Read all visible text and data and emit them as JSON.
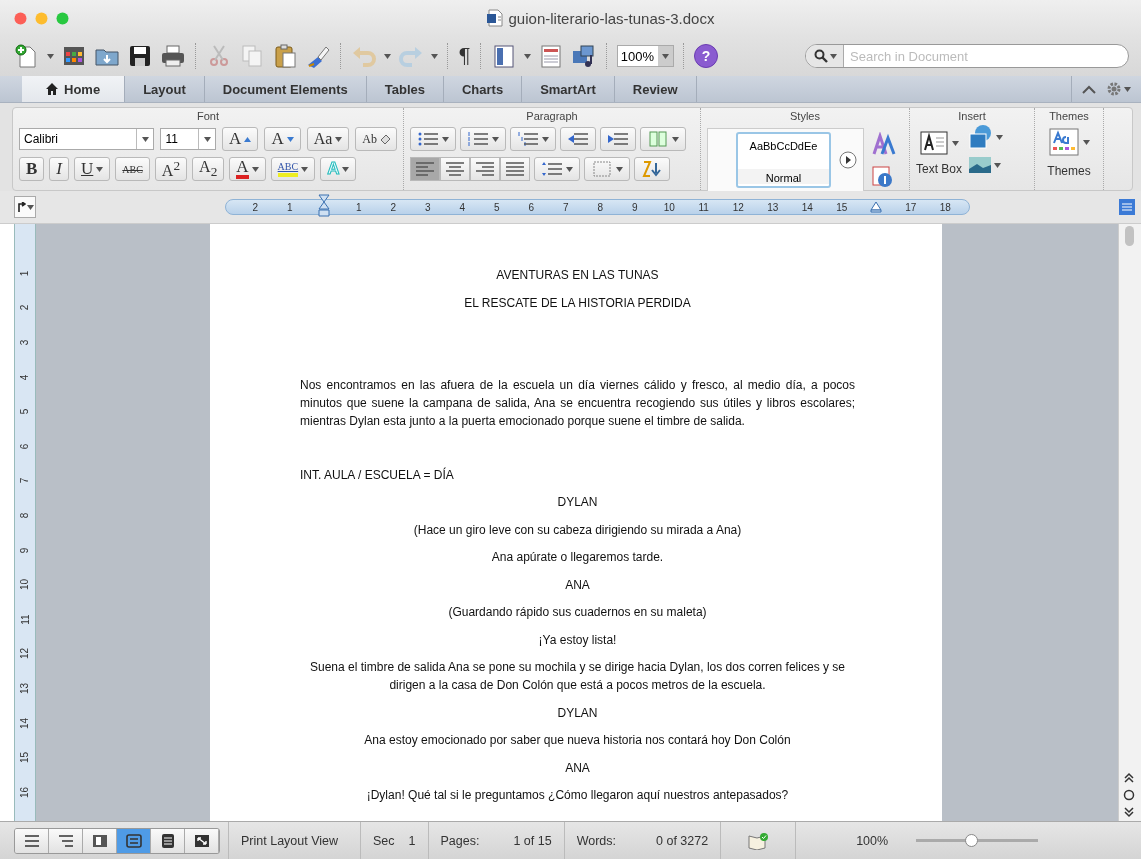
{
  "window": {
    "title": "guion-literario-las-tunas-3.docx"
  },
  "toolbar": {
    "pilcrow": "¶",
    "zoom": "100%",
    "help": "?",
    "search": {
      "placeholder": "Search in Document"
    }
  },
  "tabs": [
    {
      "label": "Home",
      "selected": true
    },
    {
      "label": "Layout",
      "selected": false
    },
    {
      "label": "Document Elements",
      "selected": false
    },
    {
      "label": "Tables",
      "selected": false
    },
    {
      "label": "Charts",
      "selected": false
    },
    {
      "label": "SmartArt",
      "selected": false
    },
    {
      "label": "Review",
      "selected": false
    }
  ],
  "ribbon": {
    "font": {
      "title": "Font",
      "font_name": "Calibri",
      "font_size": "11",
      "row1": [
        {
          "label": "A",
          "kind": "grow"
        },
        {
          "label": "A",
          "kind": "shrink"
        },
        {
          "label": "Aa",
          "kind": "case"
        },
        {
          "label": "Ab",
          "kind": "clear"
        }
      ],
      "row2": [
        {
          "label": "B",
          "kind": "bold"
        },
        {
          "label": "I",
          "kind": "italic"
        },
        {
          "label": "U",
          "kind": "underline"
        },
        {
          "label": "ABC",
          "kind": "strike"
        },
        {
          "label": "A$^{2}$",
          "kind": "superscript"
        },
        {
          "label": "A$_{2}$",
          "kind": "subscript"
        },
        {
          "label": "A",
          "kind": "font_color"
        },
        {
          "label": "ABC",
          "kind": "highlight"
        },
        {
          "label": "A",
          "kind": "effects"
        }
      ]
    },
    "paragraph": {
      "title": "Paragraph",
      "alignment": [
        {
          "selected": true
        },
        {
          "selected": false
        },
        {
          "selected": false
        },
        {
          "selected": false
        }
      ]
    },
    "styles": {
      "title": "Styles",
      "sample": "AaBbCcDdEe",
      "style_name": "Normal"
    },
    "insert": {
      "title": "Insert",
      "text_box": "Text Box"
    },
    "themes": {
      "title": "Themes",
      "label": "Themes"
    }
  },
  "ruler": {
    "marks": [
      {
        "kind": "number",
        "label": "2"
      },
      {
        "kind": "number",
        "label": "1"
      },
      {
        "kind": "first_line_indent"
      },
      {
        "kind": "number",
        "label": "1"
      },
      {
        "kind": "number",
        "label": "2"
      },
      {
        "kind": "number",
        "label": "3"
      },
      {
        "kind": "number",
        "label": "4"
      },
      {
        "kind": "number",
        "label": "5"
      },
      {
        "kind": "number",
        "label": "6"
      },
      {
        "kind": "number",
        "label": "7"
      },
      {
        "kind": "number",
        "label": "8"
      },
      {
        "kind": "number",
        "label": "9"
      },
      {
        "kind": "number",
        "label": "10"
      },
      {
        "kind": "number",
        "label": "11"
      },
      {
        "kind": "number",
        "label": "12"
      },
      {
        "kind": "number",
        "label": "13"
      },
      {
        "kind": "number",
        "label": "14"
      },
      {
        "kind": "number",
        "label": "15"
      },
      {
        "kind": "right_indent"
      },
      {
        "kind": "number",
        "label": "17"
      },
      {
        "kind": "number",
        "label": "18"
      }
    ]
  },
  "vertical_ruler": {
    "labels": [
      "1",
      "2",
      "3",
      "4",
      "5",
      "6",
      "7",
      "8",
      "9",
      "10",
      "11",
      "12",
      "13",
      "14",
      "15",
      "16"
    ]
  },
  "document": {
    "paragraphs": [
      {
        "kind": "title",
        "text": "AVENTURAS EN LAS TUNAS"
      },
      {
        "kind": "title",
        "text": "EL RESCATE DE LA HISTORIA PERDIDA"
      },
      {
        "kind": "action",
        "text": "Nos encontramos en las afuera de la escuela un día viernes cálido y fresco, al medio día, a pocos minutos que suene la campana de salida, Ana se encuentra recogiendo sus útiles y libros escolares; mientras Dylan esta junto a la puerta emocionado porque suene el timbre de salida."
      },
      {
        "kind": "scene",
        "text": "INT. AULA / ESCUELA = DÍA"
      },
      {
        "kind": "character",
        "text": "DYLAN"
      },
      {
        "kind": "parenthetical",
        "text": "(Hace un giro leve con su cabeza dirigiendo su mirada a Ana)"
      },
      {
        "kind": "dialogue",
        "text": "Ana apúrate o llegaremos tarde."
      },
      {
        "kind": "character",
        "text": "ANA"
      },
      {
        "kind": "parenthetical",
        "text": "(Guardando rápido sus cuadernos en su maleta)"
      },
      {
        "kind": "dialogue",
        "text": "¡Ya estoy lista!"
      },
      {
        "kind": "centered",
        "text": "Suena el timbre de salida Ana se pone su mochila y se dirige hacia Dylan, los dos corren felices y se dirigen a la casa de Don Colón que está a pocos metros de la escuela."
      },
      {
        "kind": "character",
        "text": "DYLAN"
      },
      {
        "kind": "dialogue",
        "text": "Ana estoy emocionado por saber que nueva historia nos contará hoy Don Colón"
      },
      {
        "kind": "character",
        "text": "ANA"
      },
      {
        "kind": "dialogue",
        "text": "¡Dylan! Qué tal si le preguntamos ¿Cómo llegaron aquí nuestros antepasados?"
      }
    ]
  },
  "status_bar": {
    "views": [
      {
        "selected": false
      },
      {
        "selected": false
      },
      {
        "selected": false
      },
      {
        "selected": true
      },
      {
        "selected": false
      },
      {
        "selected": false
      }
    ],
    "view_name": "Print Layout View",
    "section_label": "Sec",
    "section": "1",
    "pages_label": "Pages:",
    "pages": "1 of 15",
    "words_label": "Words:",
    "words": "0 of 3272",
    "zoom": "100%",
    "zoom_slider": {
      "level": 0.45
    }
  }
}
